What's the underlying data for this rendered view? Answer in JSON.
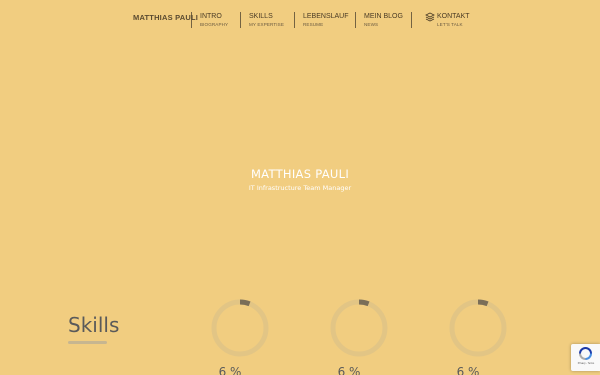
{
  "nav": {
    "brand": "MATTHIAS PAULI",
    "items": [
      {
        "label": "INTRO",
        "sub": "BIOGRAPHY"
      },
      {
        "label": "SKILLS",
        "sub": "MY EXPERTISE"
      },
      {
        "label": "LEBENSLAUF",
        "sub": "RESUME"
      },
      {
        "label": "MEIN BLOG",
        "sub": "NEWS"
      },
      {
        "label": "KONTAKT",
        "sub": "LET'S TALK"
      }
    ],
    "contact_icon": "layers-icon"
  },
  "hero": {
    "name": "MATTHIAS PAULI",
    "subtitle": "IT Infrastructure Team Manager"
  },
  "skills": {
    "title": "Skills",
    "rings": [
      {
        "percent_text": "6 %",
        "value": 0.06
      },
      {
        "percent_text": "6 %",
        "value": 0.06
      },
      {
        "percent_text": "6 %",
        "value": 0.06
      }
    ]
  },
  "recaptcha": {
    "icon": "recaptcha-icon",
    "label": "Privacy - Terms"
  },
  "colors": {
    "background": "#f1cd80",
    "ring_track": "#e2c585",
    "ring_fill": "#7a6e58",
    "hero_text": "#ffffff"
  }
}
